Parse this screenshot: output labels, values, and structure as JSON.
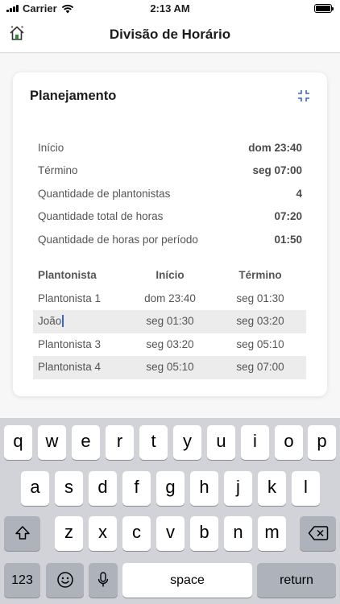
{
  "status_bar": {
    "carrier": "Carrier",
    "time": "2:13 AM"
  },
  "nav": {
    "title": "Divisão de Horário",
    "home_icon": "home-icon"
  },
  "card": {
    "title": "Planejamento",
    "collapse_icon": "collapse-icon",
    "summary": [
      {
        "label": "Início",
        "value": "dom 23:40"
      },
      {
        "label": "Término",
        "value": "seg 07:00"
      },
      {
        "label": "Quantidade de plantonistas",
        "value": "4"
      },
      {
        "label": "Quantidade total de horas",
        "value": "07:20"
      },
      {
        "label": "Quantidade de horas por período",
        "value": "01:50"
      }
    ],
    "table": {
      "headers": [
        "Plantonista",
        "Início",
        "Término"
      ],
      "rows": [
        [
          "Plantonista 1",
          "dom 23:40",
          "seg 01:30"
        ],
        [
          "João",
          "seg 01:30",
          "seg 03:20"
        ],
        [
          "Plantonista 3",
          "seg 03:20",
          "seg 05:10"
        ],
        [
          "Plantonista 4",
          "seg 05:10",
          "seg 07:00"
        ]
      ]
    }
  },
  "keyboard": {
    "row1": [
      "q",
      "w",
      "e",
      "r",
      "t",
      "y",
      "u",
      "i",
      "o",
      "p"
    ],
    "row2": [
      "a",
      "s",
      "d",
      "f",
      "g",
      "h",
      "j",
      "k",
      "l"
    ],
    "row3": [
      "z",
      "x",
      "c",
      "v",
      "b",
      "n",
      "m"
    ],
    "numbers_label": "123",
    "space_label": "space",
    "return_label": "return",
    "shift_icon": "shift-icon",
    "delete_icon": "delete-icon",
    "emoji_icon": "emoji-icon",
    "mic_icon": "microphone-icon"
  }
}
